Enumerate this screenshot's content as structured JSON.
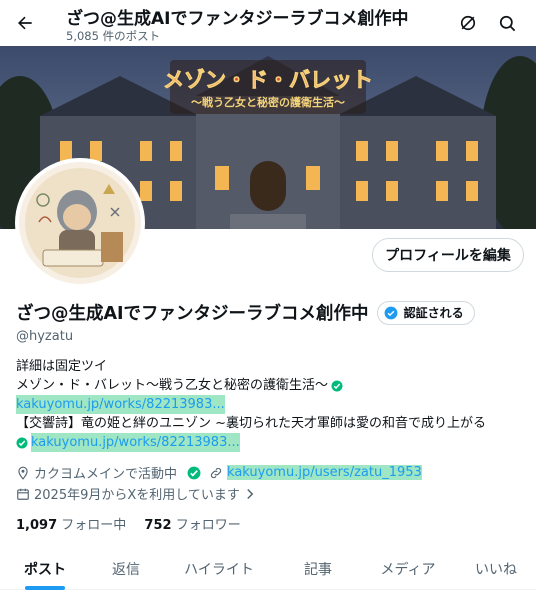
{
  "header": {
    "title": "ざつ@生成AIでファンタジーラブコメ創作中",
    "post_count": "5,085 件のポスト"
  },
  "banner": {
    "title": "メゾン・ド・バレット",
    "subtitle": "〜戦う乙女と秘密の護衛生活〜"
  },
  "profile": {
    "edit_button": "プロフィールを編集",
    "name": "ざつ@生成AIでファンタジーラブコメ創作中",
    "verify_button": "認証される",
    "handle": "@hyzatu",
    "bio": {
      "line1": "詳細は固定ツイ",
      "line2": "メゾン・ド・バレット〜戦う乙女と秘密の護衛生活〜",
      "link1": "kakuyomu.jp/works/82213983...",
      "line3": "【交響詩】竜の姫と絆のユニゾン ~裏切られた天才軍師は愛の和音で成り上がる",
      "link2": "kakuyomu.jp/works/82213983..."
    },
    "location": "カクヨムメインで活動中",
    "website": "kakuyomu.jp/users/zatu_1953",
    "joined": "2025年9月からXを利用しています",
    "following_count": "1,097",
    "following_label": "フォロー中",
    "followers_count": "752",
    "followers_label": "フォロワー"
  },
  "tabs": [
    "ポスト",
    "返信",
    "ハイライト",
    "記事",
    "メディア",
    "いいね"
  ],
  "colors": {
    "accent": "#1d9bf0",
    "link_highlight": "#9ee6c4",
    "check_green": "#00ba7c",
    "banner_title": "#c0392b"
  }
}
